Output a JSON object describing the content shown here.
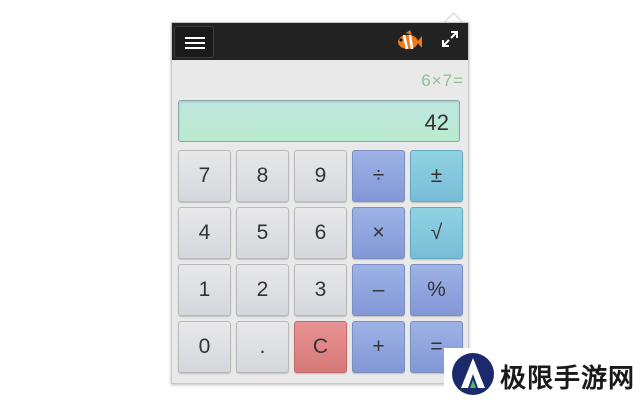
{
  "topbar": {
    "menu_icon": "hamburger-menu-icon",
    "fish_icon": "clownfish-icon",
    "expand_icon": "expand-arrows-icon"
  },
  "display": {
    "expression": "6×7=",
    "value": "42"
  },
  "keys": [
    [
      "7",
      "8",
      "9",
      "÷",
      "±"
    ],
    [
      "4",
      "5",
      "6",
      "×",
      "√"
    ],
    [
      "1",
      "2",
      "3",
      "–",
      "%"
    ],
    [
      "0",
      ".",
      "C",
      "+",
      "="
    ]
  ],
  "colors": {
    "number_key": "#d9dce0",
    "operator_key": "#8fa4dd",
    "function_key": "#84c8dd",
    "clear_key": "#e08484",
    "display_bg": "#bde9d8",
    "expression_text": "#8ec38e",
    "topbar": "#222222"
  },
  "watermark": {
    "text": "极限手游网",
    "logo_icon": "watermark-logo-icon"
  }
}
